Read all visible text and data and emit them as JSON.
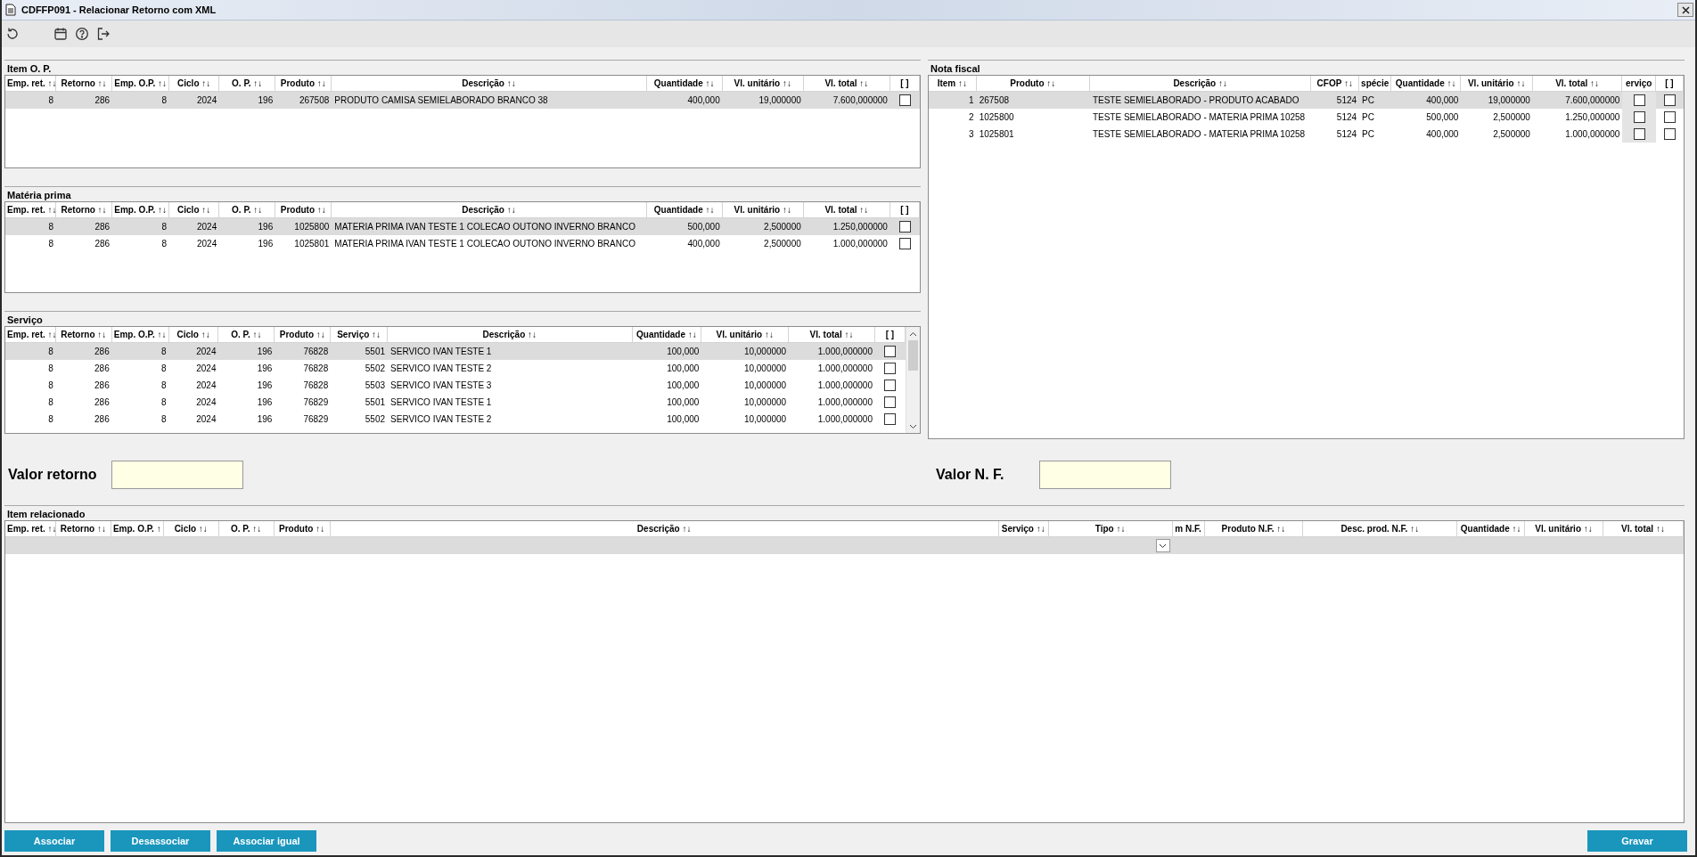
{
  "window": {
    "title": "CDFFP091 - Relacionar Retorno com XML"
  },
  "item_op": {
    "title": "Item O. P.",
    "columns": [
      {
        "label": "Emp. ret. ↑↓"
      },
      {
        "label": "Retorno ↑↓"
      },
      {
        "label": "Emp. O.P. ↑↓"
      },
      {
        "label": "Ciclo ↑↓"
      },
      {
        "label": "O. P. ↑↓"
      },
      {
        "label": "Produto ↑↓"
      },
      {
        "label": "Descrição ↑↓"
      },
      {
        "label": "Quantidade ↑↓"
      },
      {
        "label": "Vl. unitário ↑↓"
      },
      {
        "label": "Vl. total ↑↓"
      },
      {
        "label": "[ ]"
      }
    ],
    "rows": [
      {
        "selected": true,
        "cells": [
          "8",
          "286",
          "8",
          "2024",
          "196",
          "267508",
          "PRODUTO CAMISA SEMIELABORADO BRANCO 38",
          "400,000",
          "19,000000",
          "7.600,000000",
          false
        ]
      }
    ]
  },
  "materia_prima": {
    "title": "Matéria prima",
    "columns": [
      {
        "label": "Emp. ret. ↑↓"
      },
      {
        "label": "Retorno ↑↓"
      },
      {
        "label": "Emp. O.P. ↑↓"
      },
      {
        "label": "Ciclo ↑↓"
      },
      {
        "label": "O. P. ↑↓"
      },
      {
        "label": "Produto ↑↓"
      },
      {
        "label": "Descrição ↑↓"
      },
      {
        "label": "Quantidade ↑↓"
      },
      {
        "label": "Vl. unitário ↑↓"
      },
      {
        "label": "Vl. total ↑↓"
      },
      {
        "label": "[ ]"
      }
    ],
    "rows": [
      {
        "selected": true,
        "cells": [
          "8",
          "286",
          "8",
          "2024",
          "196",
          "1025800",
          "MATERIA PRIMA IVAN TESTE 1 COLECAO OUTONO INVERNO BRANCO",
          "500,000",
          "2,500000",
          "1.250,000000",
          false
        ]
      },
      {
        "selected": false,
        "cells": [
          "8",
          "286",
          "8",
          "2024",
          "196",
          "1025801",
          "MATERIA PRIMA IVAN TESTE 1 COLECAO OUTONO INVERNO BRANCO",
          "400,000",
          "2,500000",
          "1.000,000000",
          false
        ]
      }
    ]
  },
  "servico": {
    "title": "Serviço",
    "columns": [
      {
        "label": "Emp. ret. ↑↓"
      },
      {
        "label": "Retorno ↑↓"
      },
      {
        "label": "Emp. O.P. ↑↓"
      },
      {
        "label": "Ciclo ↑↓"
      },
      {
        "label": "O. P. ↑↓"
      },
      {
        "label": "Produto ↑↓"
      },
      {
        "label": "Serviço ↑↓"
      },
      {
        "label": "Descrição ↑↓"
      },
      {
        "label": "Quantidade ↑↓"
      },
      {
        "label": "Vl. unitário ↑↓"
      },
      {
        "label": "Vl. total ↑↓"
      },
      {
        "label": "[ ]"
      }
    ],
    "rows": [
      {
        "selected": true,
        "cells": [
          "8",
          "286",
          "8",
          "2024",
          "196",
          "76828",
          "5501",
          "SERVICO IVAN TESTE 1",
          "100,000",
          "10,000000",
          "1.000,000000",
          false
        ]
      },
      {
        "selected": false,
        "cells": [
          "8",
          "286",
          "8",
          "2024",
          "196",
          "76828",
          "5502",
          "SERVICO IVAN TESTE 2",
          "100,000",
          "10,000000",
          "1.000,000000",
          false
        ]
      },
      {
        "selected": false,
        "cells": [
          "8",
          "286",
          "8",
          "2024",
          "196",
          "76828",
          "5503",
          "SERVICO IVAN TESTE 3",
          "100,000",
          "10,000000",
          "1.000,000000",
          false
        ]
      },
      {
        "selected": false,
        "cells": [
          "8",
          "286",
          "8",
          "2024",
          "196",
          "76829",
          "5501",
          "SERVICO IVAN TESTE 1",
          "100,000",
          "10,000000",
          "1.000,000000",
          false
        ]
      },
      {
        "selected": false,
        "cells": [
          "8",
          "286",
          "8",
          "2024",
          "196",
          "76829",
          "5502",
          "SERVICO IVAN TESTE 2",
          "100,000",
          "10,000000",
          "1.000,000000",
          false
        ]
      }
    ]
  },
  "nota_fiscal": {
    "title": "Nota fiscal",
    "columns": [
      {
        "label": "Item ↑↓"
      },
      {
        "label": "Produto ↑↓"
      },
      {
        "label": "Descrição ↑↓"
      },
      {
        "label": "CFOP ↑↓"
      },
      {
        "label": "spécie"
      },
      {
        "label": "Quantidade ↑↓"
      },
      {
        "label": "Vl. unitário ↑↓"
      },
      {
        "label": "Vl. total ↑↓"
      },
      {
        "label": "erviço",
        "disabled": true
      },
      {
        "label": "[ ]"
      }
    ],
    "rows": [
      {
        "selected": true,
        "cells": [
          "1",
          "267508",
          "TESTE SEMIELABORADO - PRODUTO ACABADO",
          "5124",
          "PC",
          "400,000",
          "19,000000",
          "7.600,000000",
          false,
          false
        ]
      },
      {
        "selected": false,
        "cells": [
          "2",
          "1025800",
          "TESTE SEMIELABORADO - MATERIA PRIMA 10258",
          "5124",
          "PC",
          "500,000",
          "2,500000",
          "1.250,000000",
          false,
          false
        ]
      },
      {
        "selected": false,
        "cells": [
          "3",
          "1025801",
          "TESTE SEMIELABORADO - MATERIA PRIMA 10258",
          "5124",
          "PC",
          "400,000",
          "2,500000",
          "1.000,000000",
          false,
          false
        ]
      }
    ]
  },
  "values": [
    {
      "label": "Valor retorno"
    },
    {
      "label": "Valor N. F."
    }
  ],
  "item_relacionado": {
    "title": "Item relacionado",
    "columns": [
      {
        "label": "Emp. ret. ↑↓"
      },
      {
        "label": "Retorno ↑↓"
      },
      {
        "label": "Emp. O.P. ↑"
      },
      {
        "label": "Ciclo ↑↓"
      },
      {
        "label": "O. P. ↑↓"
      },
      {
        "label": "Produto ↑↓"
      },
      {
        "label": "Descrição ↑↓"
      },
      {
        "label": "Serviço ↑↓"
      },
      {
        "label": "Tipo ↑↓",
        "kind": "dropdown"
      },
      {
        "label": "m N.F."
      },
      {
        "label": "Produto N.F. ↑↓"
      },
      {
        "label": "Desc. prod. N.F. ↑↓"
      },
      {
        "label": "Quantidade ↑↓"
      },
      {
        "label": "Vl. unitário ↑↓"
      },
      {
        "label": "Vl. total ↑↓"
      }
    ],
    "rows": [
      {
        "selected": true
      }
    ]
  },
  "buttons_left": [
    "Associar",
    "Desassociar",
    "Associar igual"
  ],
  "buttons_right": [
    "Gravar"
  ]
}
